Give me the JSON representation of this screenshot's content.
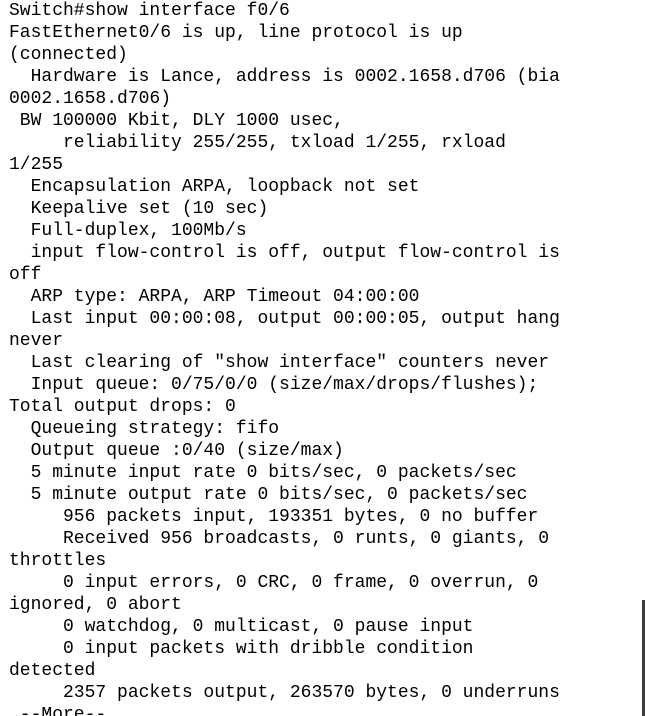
{
  "terminal": {
    "lines": [
      "Switch#show interface f0/6",
      "FastEthernet0/6 is up, line protocol is up",
      "(connected)",
      "  Hardware is Lance, address is 0002.1658.d706 (bia",
      "0002.1658.d706)",
      " BW 100000 Kbit, DLY 1000 usec,",
      "     reliability 255/255, txload 1/255, rxload",
      "1/255",
      "  Encapsulation ARPA, loopback not set",
      "  Keepalive set (10 sec)",
      "  Full-duplex, 100Mb/s",
      "  input flow-control is off, output flow-control is",
      "off",
      "  ARP type: ARPA, ARP Timeout 04:00:00",
      "  Last input 00:00:08, output 00:00:05, output hang",
      "never",
      "  Last clearing of \"show interface\" counters never",
      "  Input queue: 0/75/0/0 (size/max/drops/flushes);",
      "Total output drops: 0",
      "  Queueing strategy: fifo",
      "  Output queue :0/40 (size/max)",
      "  5 minute input rate 0 bits/sec, 0 packets/sec",
      "  5 minute output rate 0 bits/sec, 0 packets/sec",
      "     956 packets input, 193351 bytes, 0 no buffer",
      "     Received 956 broadcasts, 0 runts, 0 giants, 0",
      "throttles",
      "     0 input errors, 0 CRC, 0 frame, 0 overrun, 0",
      "ignored, 0 abort",
      "     0 watchdog, 0 multicast, 0 pause input",
      "     0 input packets with dribble condition",
      "detected",
      "     2357 packets output, 263570 bytes, 0 underruns"
    ],
    "more_prompt": " --More--"
  }
}
